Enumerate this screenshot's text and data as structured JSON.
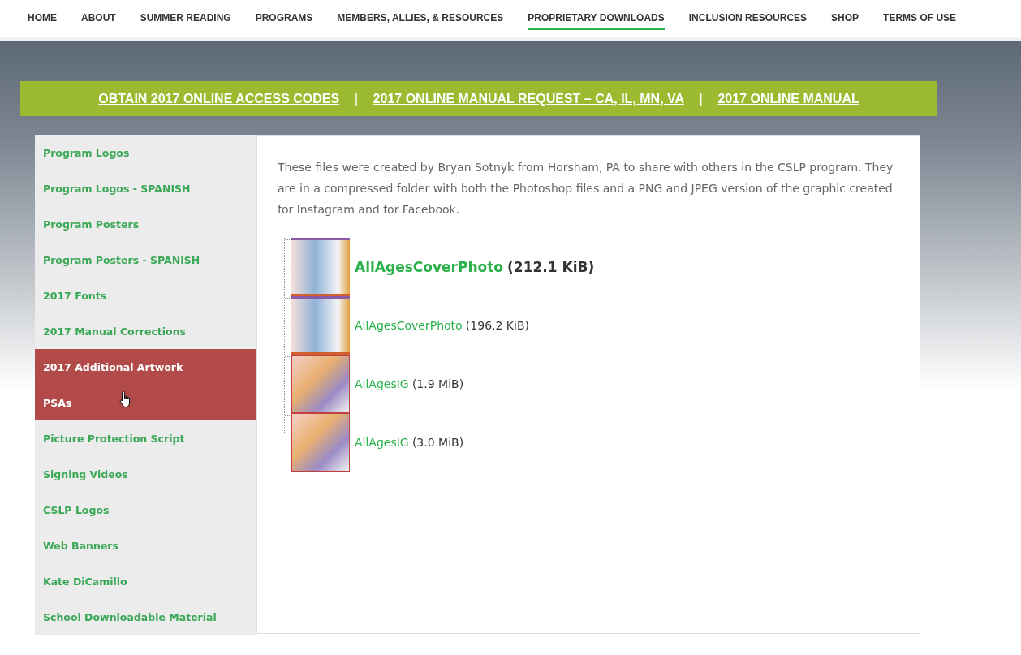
{
  "nav": {
    "items": [
      {
        "label": "HOME",
        "selected": false
      },
      {
        "label": "ABOUT",
        "selected": false
      },
      {
        "label": "SUMMER READING",
        "selected": false
      },
      {
        "label": "PROGRAMS",
        "selected": false
      },
      {
        "label": "MEMBERS, ALLIES, & RESOURCES",
        "selected": false
      },
      {
        "label": "PROPRIETARY DOWNLOADS",
        "selected": true
      },
      {
        "label": "INCLUSION RESOURCES",
        "selected": false
      },
      {
        "label": "SHOP",
        "selected": false
      },
      {
        "label": "TERMS OF USE",
        "selected": false
      }
    ]
  },
  "banner": {
    "links": [
      "OBTAIN 2017 ONLINE ACCESS CODES",
      "2017 ONLINE MANUAL REQUEST – CA, IL, MN, VA",
      "2017 ONLINE MANUAL"
    ],
    "separator": "|"
  },
  "sidebar": {
    "items": [
      {
        "label": "Program Logos",
        "highlighted": false
      },
      {
        "label": "Program Logos - SPANISH",
        "highlighted": false
      },
      {
        "label": "Program Posters",
        "highlighted": false
      },
      {
        "label": "Program Posters - SPANISH",
        "highlighted": false
      },
      {
        "label": "2017 Fonts",
        "highlighted": false
      },
      {
        "label": "2017 Manual Corrections",
        "highlighted": false
      },
      {
        "label": "2017 Additional Artwork",
        "highlighted": true
      },
      {
        "label": "PSAs",
        "highlighted": true
      },
      {
        "label": "Picture Protection Script",
        "highlighted": false
      },
      {
        "label": "Signing Videos",
        "highlighted": false
      },
      {
        "label": "CSLP Logos",
        "highlighted": false
      },
      {
        "label": "Web Banners",
        "highlighted": false
      },
      {
        "label": "Kate DiCamillo",
        "highlighted": false
      },
      {
        "label": "School Downloadable Material",
        "highlighted": false
      }
    ]
  },
  "content": {
    "description": "These files were created by Bryan Sotnyk from Horsham, PA to share with others in the CSLP program. They are in a compressed folder with both the Photoshop files and a PNG and JPEG version of the graphic created for Instagram and for Facebook.",
    "files": [
      {
        "name": "AllAgesCoverPhoto",
        "size": "(212.1 KiB)",
        "emphasized": true,
        "kind": "wide"
      },
      {
        "name": "AllAgesCoverPhoto",
        "size": "(196.2 KiB)",
        "emphasized": false,
        "kind": "wide"
      },
      {
        "name": "AllAgesIG",
        "size": "(1.9 MiB)",
        "emphasized": false,
        "kind": "square"
      },
      {
        "name": "AllAgesIG",
        "size": "(3.0 MiB)",
        "emphasized": false,
        "kind": "square"
      }
    ]
  }
}
